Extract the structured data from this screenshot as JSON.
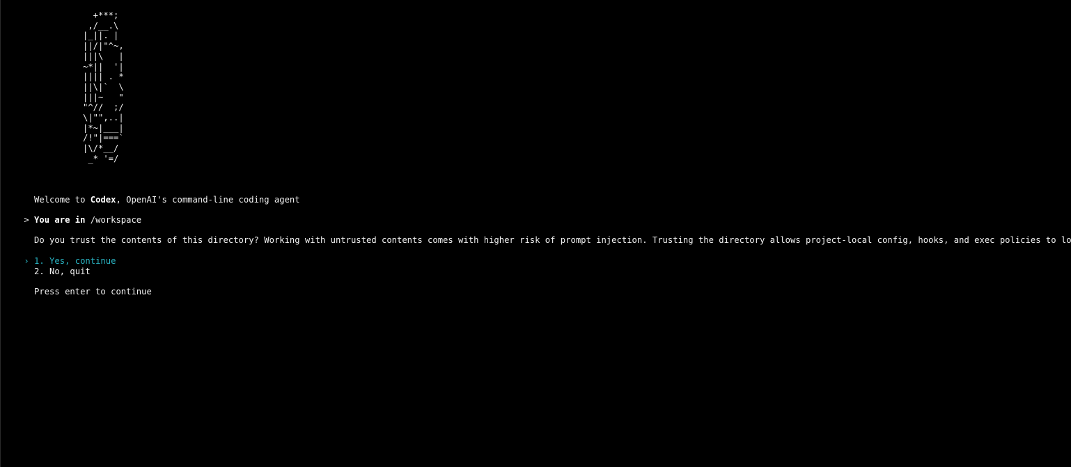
{
  "logo_art": "  +***;\n ,/__.\\\n|_||. |\n||/|\"^~,\n|||\\   |\n~*||  '|\n|||| . *\n||\\|`  \\\n|||~   \"\n\"^//  ;/\n\\|\"\",..|\n|*~|___|\n/!\"|===`\n|\\/*__/\n _* '=/",
  "welcome": {
    "prefix": "Welcome to ",
    "product": "Codex",
    "suffix": ", OpenAI's command-line coding agent"
  },
  "location": {
    "prompt_symbol": ">",
    "label": "You are in",
    "path": "/workspace"
  },
  "trust_question": "Do you trust the contents of this directory? Working with untrusted contents comes with higher risk of prompt injection. Trusting the directory allows project-local config, hooks, and exec policies to load.",
  "options": [
    {
      "marker": "›",
      "label": "1. Yes, continue",
      "selected": true
    },
    {
      "marker": "",
      "label": "2. No, quit",
      "selected": false
    }
  ],
  "hint": "Press enter to continue",
  "colors": {
    "background": "#000000",
    "foreground": "#f2f2f2",
    "selected": "#2ab5c4"
  }
}
